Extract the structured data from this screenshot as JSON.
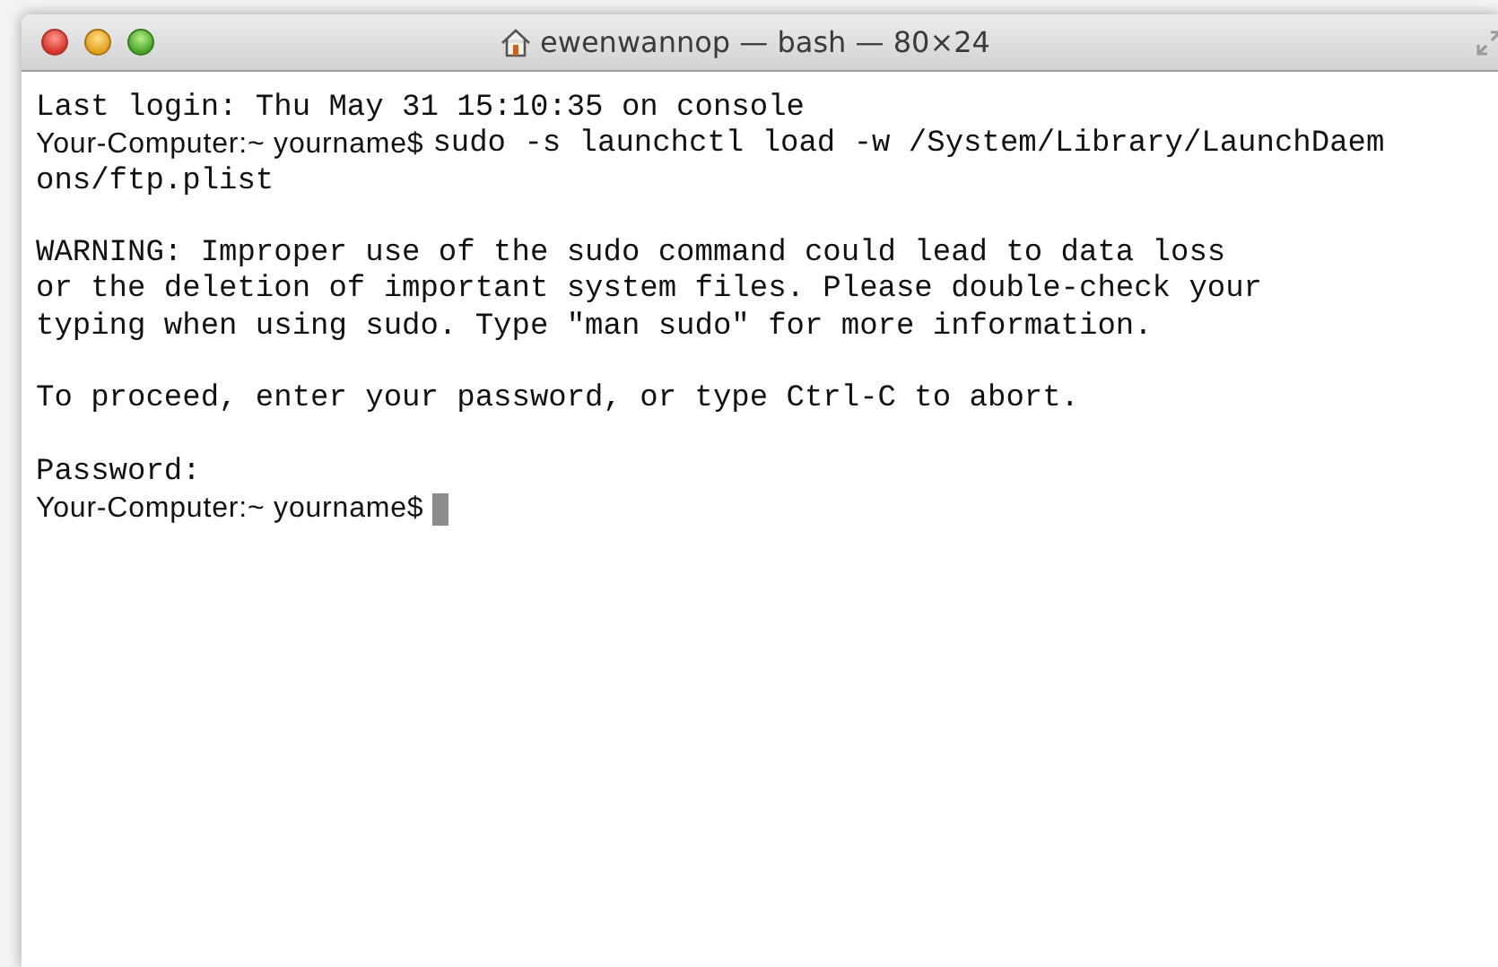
{
  "window": {
    "title": "ewenwannop — bash — 80×24"
  },
  "terminal": {
    "blocks": [
      {
        "lines": [
          {
            "text": "Last login: Thu May 31 15:10:35 on console",
            "cursor": false
          },
          {
            "prompt": "Your-Computer:~ yourname$",
            "text": "sudo -s launchctl load -w /System/Library/LaunchDaem",
            "cursor": false
          },
          {
            "text": "ons/ftp.plist",
            "cursor": false
          }
        ]
      },
      {
        "lines": [
          {
            "text": "WARNING: Improper use of the sudo command could lead to data loss",
            "cursor": false
          },
          {
            "text": "or the deletion of important system files. Please double-check your",
            "cursor": false
          },
          {
            "text": "typing when using sudo. Type \"man sudo\" for more information.",
            "cursor": false
          }
        ]
      },
      {
        "lines": [
          {
            "text": "To proceed, enter your password, or type Ctrl-C to abort.",
            "cursor": false
          }
        ]
      },
      {
        "lines": [
          {
            "text": "Password:",
            "cursor": false
          },
          {
            "prompt": "Your-Computer:~ yourname$",
            "cursor": true
          }
        ]
      }
    ]
  }
}
